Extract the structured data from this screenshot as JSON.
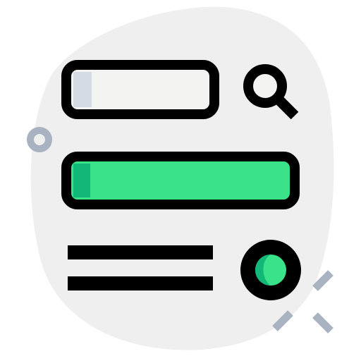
{
  "illustration": {
    "icons": {
      "search_bar": "search-field-icon",
      "search": "magnifier-icon",
      "primary_bar": "filled-input-bar-icon",
      "text_lines": "text-lines-icon",
      "radio": "radio-button-icon",
      "decor_ring": "ring-decoration-icon",
      "decor_sparkle": "sparkle-decoration-icon"
    },
    "colors": {
      "blob": "#efefef",
      "outline": "#000000",
      "field_fill": "#f3f3f1",
      "field_shade": "#d5dbe5",
      "accent_green": "#3ae28a",
      "accent_green_dark": "#12b878",
      "decor_gray": "#a9b2c1"
    }
  }
}
